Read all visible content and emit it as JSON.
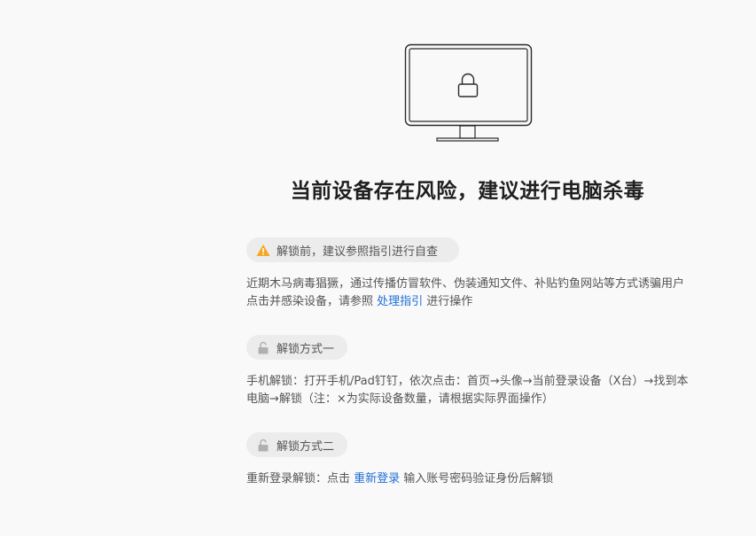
{
  "main": {
    "title": "当前设备存在风险，建议进行电脑杀毒"
  },
  "sections": {
    "precheck": {
      "label": "解锁前，建议参照指引进行自查",
      "text_before": "近期木马病毒猖獗，通过传播仿冒软件、伪装通知文件、补贴钓鱼网站等方式诱骗用户点击并感染设备，请参照 ",
      "link": "处理指引",
      "text_after": " 进行操作"
    },
    "method1": {
      "label": "解锁方式一",
      "text": "手机解锁：打开手机/Pad钉钉，依次点击：首页→头像→当前登录设备（X台）→找到本电脑→解锁（注：×为实际设备数量，请根据实际界面操作）"
    },
    "method2": {
      "label": "解锁方式二",
      "text_before": "重新登录解锁：点击 ",
      "link": "重新登录",
      "text_after": " 输入账号密码验证身份后解锁"
    }
  },
  "colors": {
    "warning": "#f5a623",
    "link": "#1e6fd9",
    "title": "#1f1f1f",
    "lock": "#b0b0b0"
  }
}
